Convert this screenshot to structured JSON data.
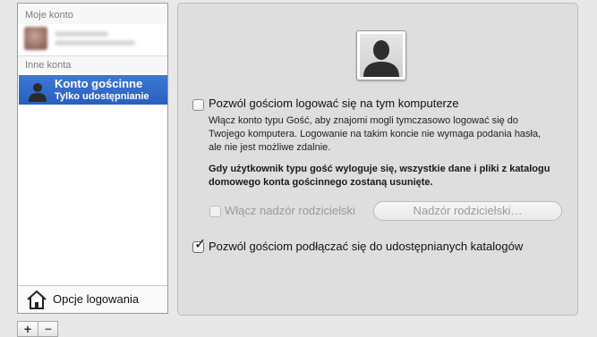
{
  "sidebar": {
    "my_account_header": "Moje konto",
    "other_accounts_header": "Inne konta",
    "selected_account": {
      "title": "Konto gościnne",
      "subtitle": "Tylko udostępnianie"
    },
    "login_options_label": "Opcje logowania",
    "add_button": "+",
    "remove_button": "−"
  },
  "panel": {
    "allow_login_label": "Pozwól gościom logować się na tym komputerze",
    "allow_login_checked": false,
    "description": "Włącz konto typu Gość, aby znajomi mogli tymczasowo logować się do Twojego komputera. Logowanie na takim koncie nie wymaga podania hasła, ale nie jest możliwe zdalnie.",
    "warning": "Gdy użytkownik typu gość wyloguje się, wszystkie dane i pliki z katalogu domowego konta gościnnego zostaną usunięte.",
    "parental_checkbox_label": "Włącz nadzór rodzicielski",
    "parental_checked": false,
    "parental_button_label": "Nadzór rodzicielski…",
    "shared_folders_label": "Pozwól gościom podłączać się do udostępnianych katalogów",
    "shared_folders_checked": true
  },
  "colors": {
    "selection": "#2f66c4",
    "panel_bg": "#dedede",
    "window_bg": "#e8e8e8"
  }
}
